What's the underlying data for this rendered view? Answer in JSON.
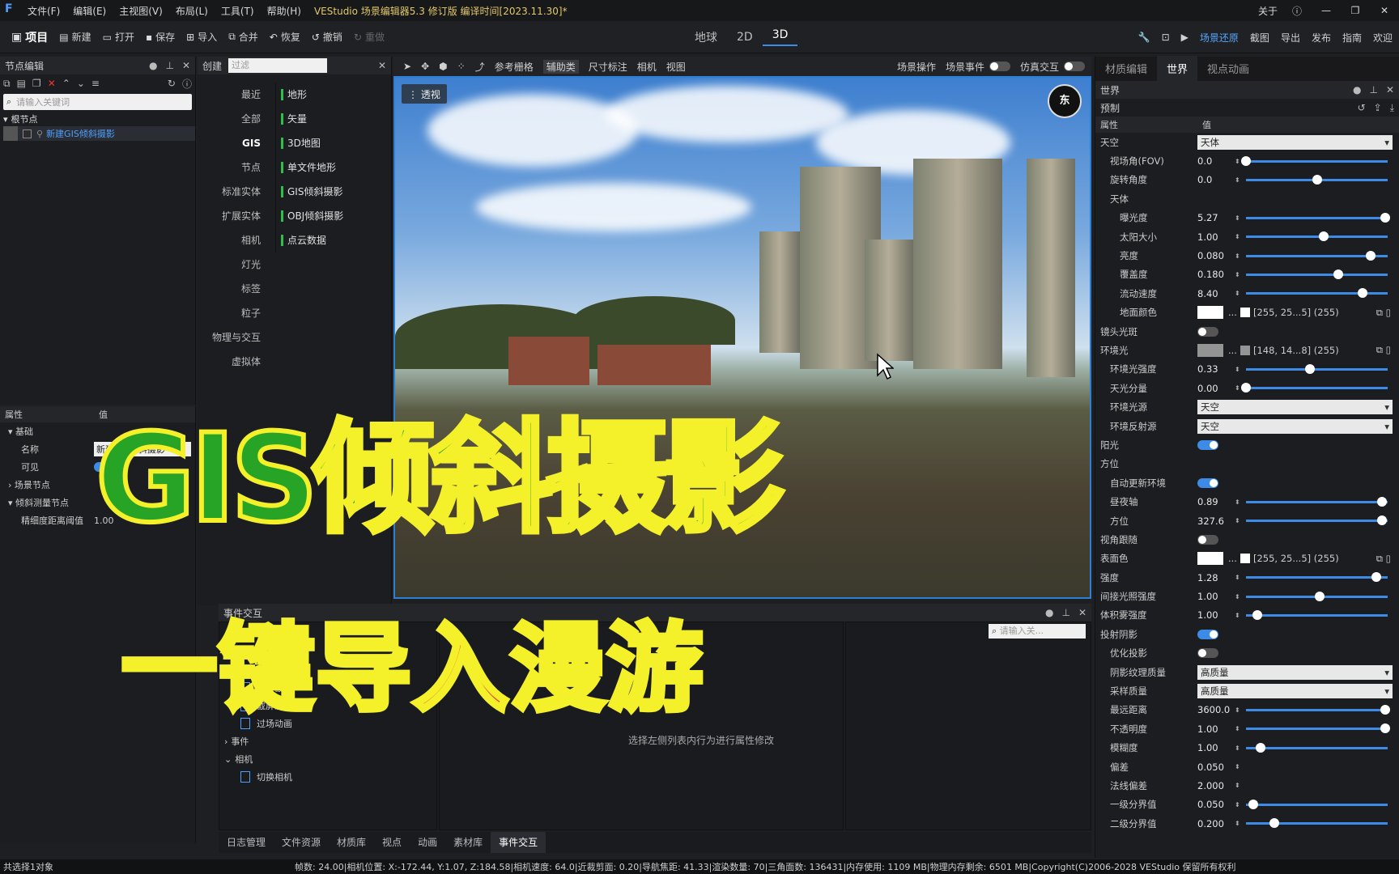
{
  "titlebar": {
    "menus": [
      "文件(F)",
      "编辑(E)",
      "主视图(V)",
      "布局(L)",
      "工具(T)",
      "帮助(H)"
    ],
    "title": "VEStudio 场景编辑器5.3 修订版 编译时间[2023.11.30]*",
    "about": "关于"
  },
  "toolbar": {
    "project": "项目",
    "new": "新建",
    "open": "打开",
    "save": "保存",
    "import": "导入",
    "merge": "合并",
    "restore": "恢复",
    "undo": "撤销",
    "redo": "重做",
    "view_tabs": [
      "地球",
      "2D",
      "3D"
    ],
    "active_view": "3D",
    "right": [
      "场景还原",
      "截图",
      "导出",
      "发布",
      "指南",
      "欢迎"
    ]
  },
  "node_panel": {
    "title": "节点编辑",
    "search_placeholder": "请输入关键词",
    "root": "根节点",
    "node": "新建GIS倾斜摄影"
  },
  "prop_panel": {
    "col_attr": "属性",
    "col_val": "值",
    "group_basic": "基础",
    "name_label": "名称",
    "name_value": "新建GIS倾斜摄影",
    "visible_label": "可见",
    "scene_node": "场景节点",
    "tilt_node": "倾斜测量节点",
    "precision_label": "精细度距离阈值",
    "precision_value": "1.00"
  },
  "create_panel": {
    "title": "创建",
    "filter_placeholder": "过滤",
    "categories": [
      "最近",
      "全部",
      "GIS",
      "节点",
      "标准实体",
      "扩展实体",
      "相机",
      "灯光",
      "标签",
      "粒子",
      "物理与交互",
      "虚拟体"
    ],
    "active_category": "GIS",
    "items": [
      "地形",
      "矢量",
      "3D地图",
      "单文件地形",
      "GIS倾斜摄影",
      "OBJ倾斜摄影",
      "点云数据"
    ]
  },
  "viewport_toolbar": {
    "items": [
      "参考栅格",
      "辅助类",
      "尺寸标注",
      "相机",
      "视图"
    ],
    "right": [
      "场景操作",
      "场景事件",
      "仿真交互"
    ]
  },
  "viewport": {
    "mode": "透视",
    "compass": "东"
  },
  "event_panel": {
    "title": "事件交互",
    "tab": "所有",
    "search_placeholder": "请输入关...",
    "items": [
      "全屏截屏",
      "截屏淡出",
      "过场动画"
    ],
    "group_event": "事件",
    "group_camera": "相机",
    "camera_item": "切换相机",
    "hint": "选择左侧列表内行为进行属性修改"
  },
  "bottom_tabs": [
    "日志管理",
    "文件资源",
    "材质库",
    "视点",
    "动画",
    "素材库",
    "事件交互"
  ],
  "active_bottom_tab": "事件交互",
  "status": {
    "left": "共选择1对象",
    "right": "帧数: 24.00|相机位置: X:-172.44, Y:1.07, Z:184.58|相机速度: 64.0|近裁剪面: 0.20|导航焦距: 41.33|渲染数量: 70|三角面数: 136431|内存使用: 1109 MB|物理内存剩余: 6501 MB|Copyright(C)2006-2028 VEStudio 保留所有权利"
  },
  "right_panel": {
    "tabs": [
      "材质编辑",
      "世界",
      "视点动画"
    ],
    "active_tab": "世界",
    "section": "世界",
    "preset": "预制",
    "col_attr": "属性",
    "col_val": "值",
    "rows": [
      {
        "k": "天空",
        "type": "select",
        "v": "天体",
        "indent": 0
      },
      {
        "k": "视场角(FOV)",
        "type": "slider",
        "v": "0.0",
        "pos": 0.0,
        "indent": 1
      },
      {
        "k": "旋转角度",
        "type": "slider",
        "v": "0.0",
        "pos": 0.5,
        "indent": 1
      },
      {
        "k": "天体",
        "type": "group",
        "indent": 1
      },
      {
        "k": "曝光度",
        "type": "slider",
        "v": "5.27",
        "pos": 0.98,
        "indent": 2
      },
      {
        "k": "太阳大小",
        "type": "slider",
        "v": "1.00",
        "pos": 0.55,
        "indent": 2
      },
      {
        "k": "亮度",
        "type": "slider",
        "v": "0.080",
        "pos": 0.88,
        "indent": 2
      },
      {
        "k": "覆盖度",
        "type": "slider",
        "v": "0.180",
        "pos": 0.65,
        "indent": 2
      },
      {
        "k": "流动速度",
        "type": "slider",
        "v": "8.40",
        "pos": 0.82,
        "indent": 2
      },
      {
        "k": "地面颜色",
        "type": "color",
        "v": "[255, 25...5] (255)",
        "color": "#ffffff",
        "indent": 2
      },
      {
        "k": "镜头光斑",
        "type": "toggle",
        "on": false,
        "indent": 0
      },
      {
        "k": "环境光",
        "type": "color",
        "v": "[148, 14...8] (255)",
        "color": "#949494",
        "indent": 0
      },
      {
        "k": "环境光强度",
        "type": "slider",
        "v": "0.33",
        "pos": 0.45,
        "indent": 1
      },
      {
        "k": "天光分量",
        "type": "slider",
        "v": "0.00",
        "pos": 0.0,
        "indent": 1
      },
      {
        "k": "环境光源",
        "type": "select",
        "v": "天空",
        "indent": 1
      },
      {
        "k": "环境反射源",
        "type": "select",
        "v": "天空",
        "indent": 1
      },
      {
        "k": "阳光",
        "type": "toggle",
        "on": true,
        "indent": 0
      },
      {
        "k": "方位",
        "type": "group",
        "indent": 0
      },
      {
        "k": "自动更新环境",
        "type": "toggle",
        "on": true,
        "indent": 1
      },
      {
        "k": "昼夜轴",
        "type": "slider",
        "v": "0.89",
        "pos": 0.96,
        "indent": 1
      },
      {
        "k": "方位",
        "type": "slider",
        "v": "327.6",
        "pos": 0.96,
        "indent": 1
      },
      {
        "k": "视角跟随",
        "type": "toggle",
        "on": false,
        "indent": 0
      },
      {
        "k": "表面色",
        "type": "color",
        "v": "[255, 25...5] (255)",
        "color": "#ffffff",
        "indent": 0
      },
      {
        "k": "强度",
        "type": "slider",
        "v": "1.28",
        "pos": 0.92,
        "indent": 0
      },
      {
        "k": "间接光照强度",
        "type": "slider",
        "v": "1.00",
        "pos": 0.52,
        "indent": 0
      },
      {
        "k": "体积雾强度",
        "type": "slider",
        "v": "1.00",
        "pos": 0.08,
        "indent": 0
      },
      {
        "k": "投射阴影",
        "type": "toggle",
        "on": true,
        "indent": 0
      },
      {
        "k": "优化投影",
        "type": "toggle",
        "on": false,
        "indent": 1
      },
      {
        "k": "阴影纹理质量",
        "type": "select",
        "v": "高质量",
        "indent": 1
      },
      {
        "k": "采样质量",
        "type": "select",
        "v": "高质量",
        "indent": 1
      },
      {
        "k": "最远距离",
        "type": "slider",
        "v": "3600.0",
        "pos": 0.98,
        "indent": 1
      },
      {
        "k": "不透明度",
        "type": "slider",
        "v": "1.00",
        "pos": 0.98,
        "indent": 1
      },
      {
        "k": "模糊度",
        "type": "slider",
        "v": "1.00",
        "pos": 0.1,
        "indent": 1
      },
      {
        "k": "偏差",
        "type": "number",
        "v": "0.050",
        "indent": 1
      },
      {
        "k": "法线偏差",
        "type": "number",
        "v": "2.000",
        "indent": 1
      },
      {
        "k": "一级分界值",
        "type": "slider",
        "v": "0.050",
        "pos": 0.05,
        "indent": 1
      },
      {
        "k": "二级分界值",
        "type": "slider",
        "v": "0.200",
        "pos": 0.2,
        "indent": 1
      }
    ]
  },
  "overlay": {
    "headline": "GIS倾斜摄影",
    "subline": "一键导入漫游"
  }
}
